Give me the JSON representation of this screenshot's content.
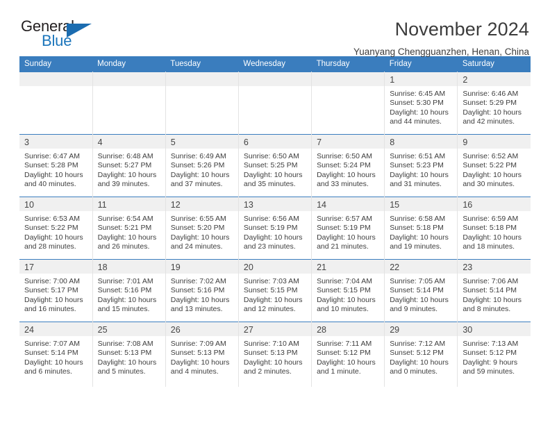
{
  "logo": {
    "word_one": "General",
    "word_two": "Blue",
    "triangle_icon": "triangle-icon",
    "brand_color": "#1b75bb"
  },
  "header": {
    "title": "November 2024",
    "subtitle": "Yuanyang Chengguanzhen, Henan, China"
  },
  "calendar": {
    "header_bg": "#3a7dbe",
    "weekdays": [
      "Sunday",
      "Monday",
      "Tuesday",
      "Wednesday",
      "Thursday",
      "Friday",
      "Saturday"
    ],
    "weeks": [
      [
        {
          "day": "",
          "lines": []
        },
        {
          "day": "",
          "lines": []
        },
        {
          "day": "",
          "lines": []
        },
        {
          "day": "",
          "lines": []
        },
        {
          "day": "",
          "lines": []
        },
        {
          "day": "1",
          "lines": [
            "Sunrise: 6:45 AM",
            "Sunset: 5:30 PM",
            "Daylight: 10 hours",
            "and 44 minutes."
          ]
        },
        {
          "day": "2",
          "lines": [
            "Sunrise: 6:46 AM",
            "Sunset: 5:29 PM",
            "Daylight: 10 hours",
            "and 42 minutes."
          ]
        }
      ],
      [
        {
          "day": "3",
          "lines": [
            "Sunrise: 6:47 AM",
            "Sunset: 5:28 PM",
            "Daylight: 10 hours",
            "and 40 minutes."
          ]
        },
        {
          "day": "4",
          "lines": [
            "Sunrise: 6:48 AM",
            "Sunset: 5:27 PM",
            "Daylight: 10 hours",
            "and 39 minutes."
          ]
        },
        {
          "day": "5",
          "lines": [
            "Sunrise: 6:49 AM",
            "Sunset: 5:26 PM",
            "Daylight: 10 hours",
            "and 37 minutes."
          ]
        },
        {
          "day": "6",
          "lines": [
            "Sunrise: 6:50 AM",
            "Sunset: 5:25 PM",
            "Daylight: 10 hours",
            "and 35 minutes."
          ]
        },
        {
          "day": "7",
          "lines": [
            "Sunrise: 6:50 AM",
            "Sunset: 5:24 PM",
            "Daylight: 10 hours",
            "and 33 minutes."
          ]
        },
        {
          "day": "8",
          "lines": [
            "Sunrise: 6:51 AM",
            "Sunset: 5:23 PM",
            "Daylight: 10 hours",
            "and 31 minutes."
          ]
        },
        {
          "day": "9",
          "lines": [
            "Sunrise: 6:52 AM",
            "Sunset: 5:22 PM",
            "Daylight: 10 hours",
            "and 30 minutes."
          ]
        }
      ],
      [
        {
          "day": "10",
          "lines": [
            "Sunrise: 6:53 AM",
            "Sunset: 5:22 PM",
            "Daylight: 10 hours",
            "and 28 minutes."
          ]
        },
        {
          "day": "11",
          "lines": [
            "Sunrise: 6:54 AM",
            "Sunset: 5:21 PM",
            "Daylight: 10 hours",
            "and 26 minutes."
          ]
        },
        {
          "day": "12",
          "lines": [
            "Sunrise: 6:55 AM",
            "Sunset: 5:20 PM",
            "Daylight: 10 hours",
            "and 24 minutes."
          ]
        },
        {
          "day": "13",
          "lines": [
            "Sunrise: 6:56 AM",
            "Sunset: 5:19 PM",
            "Daylight: 10 hours",
            "and 23 minutes."
          ]
        },
        {
          "day": "14",
          "lines": [
            "Sunrise: 6:57 AM",
            "Sunset: 5:19 PM",
            "Daylight: 10 hours",
            "and 21 minutes."
          ]
        },
        {
          "day": "15",
          "lines": [
            "Sunrise: 6:58 AM",
            "Sunset: 5:18 PM",
            "Daylight: 10 hours",
            "and 19 minutes."
          ]
        },
        {
          "day": "16",
          "lines": [
            "Sunrise: 6:59 AM",
            "Sunset: 5:18 PM",
            "Daylight: 10 hours",
            "and 18 minutes."
          ]
        }
      ],
      [
        {
          "day": "17",
          "lines": [
            "Sunrise: 7:00 AM",
            "Sunset: 5:17 PM",
            "Daylight: 10 hours",
            "and 16 minutes."
          ]
        },
        {
          "day": "18",
          "lines": [
            "Sunrise: 7:01 AM",
            "Sunset: 5:16 PM",
            "Daylight: 10 hours",
            "and 15 minutes."
          ]
        },
        {
          "day": "19",
          "lines": [
            "Sunrise: 7:02 AM",
            "Sunset: 5:16 PM",
            "Daylight: 10 hours",
            "and 13 minutes."
          ]
        },
        {
          "day": "20",
          "lines": [
            "Sunrise: 7:03 AM",
            "Sunset: 5:15 PM",
            "Daylight: 10 hours",
            "and 12 minutes."
          ]
        },
        {
          "day": "21",
          "lines": [
            "Sunrise: 7:04 AM",
            "Sunset: 5:15 PM",
            "Daylight: 10 hours",
            "and 10 minutes."
          ]
        },
        {
          "day": "22",
          "lines": [
            "Sunrise: 7:05 AM",
            "Sunset: 5:14 PM",
            "Daylight: 10 hours",
            "and 9 minutes."
          ]
        },
        {
          "day": "23",
          "lines": [
            "Sunrise: 7:06 AM",
            "Sunset: 5:14 PM",
            "Daylight: 10 hours",
            "and 8 minutes."
          ]
        }
      ],
      [
        {
          "day": "24",
          "lines": [
            "Sunrise: 7:07 AM",
            "Sunset: 5:14 PM",
            "Daylight: 10 hours",
            "and 6 minutes."
          ]
        },
        {
          "day": "25",
          "lines": [
            "Sunrise: 7:08 AM",
            "Sunset: 5:13 PM",
            "Daylight: 10 hours",
            "and 5 minutes."
          ]
        },
        {
          "day": "26",
          "lines": [
            "Sunrise: 7:09 AM",
            "Sunset: 5:13 PM",
            "Daylight: 10 hours",
            "and 4 minutes."
          ]
        },
        {
          "day": "27",
          "lines": [
            "Sunrise: 7:10 AM",
            "Sunset: 5:13 PM",
            "Daylight: 10 hours",
            "and 2 minutes."
          ]
        },
        {
          "day": "28",
          "lines": [
            "Sunrise: 7:11 AM",
            "Sunset: 5:12 PM",
            "Daylight: 10 hours",
            "and 1 minute."
          ]
        },
        {
          "day": "29",
          "lines": [
            "Sunrise: 7:12 AM",
            "Sunset: 5:12 PM",
            "Daylight: 10 hours",
            "and 0 minutes."
          ]
        },
        {
          "day": "30",
          "lines": [
            "Sunrise: 7:13 AM",
            "Sunset: 5:12 PM",
            "Daylight: 9 hours",
            "and 59 minutes."
          ]
        }
      ]
    ]
  }
}
